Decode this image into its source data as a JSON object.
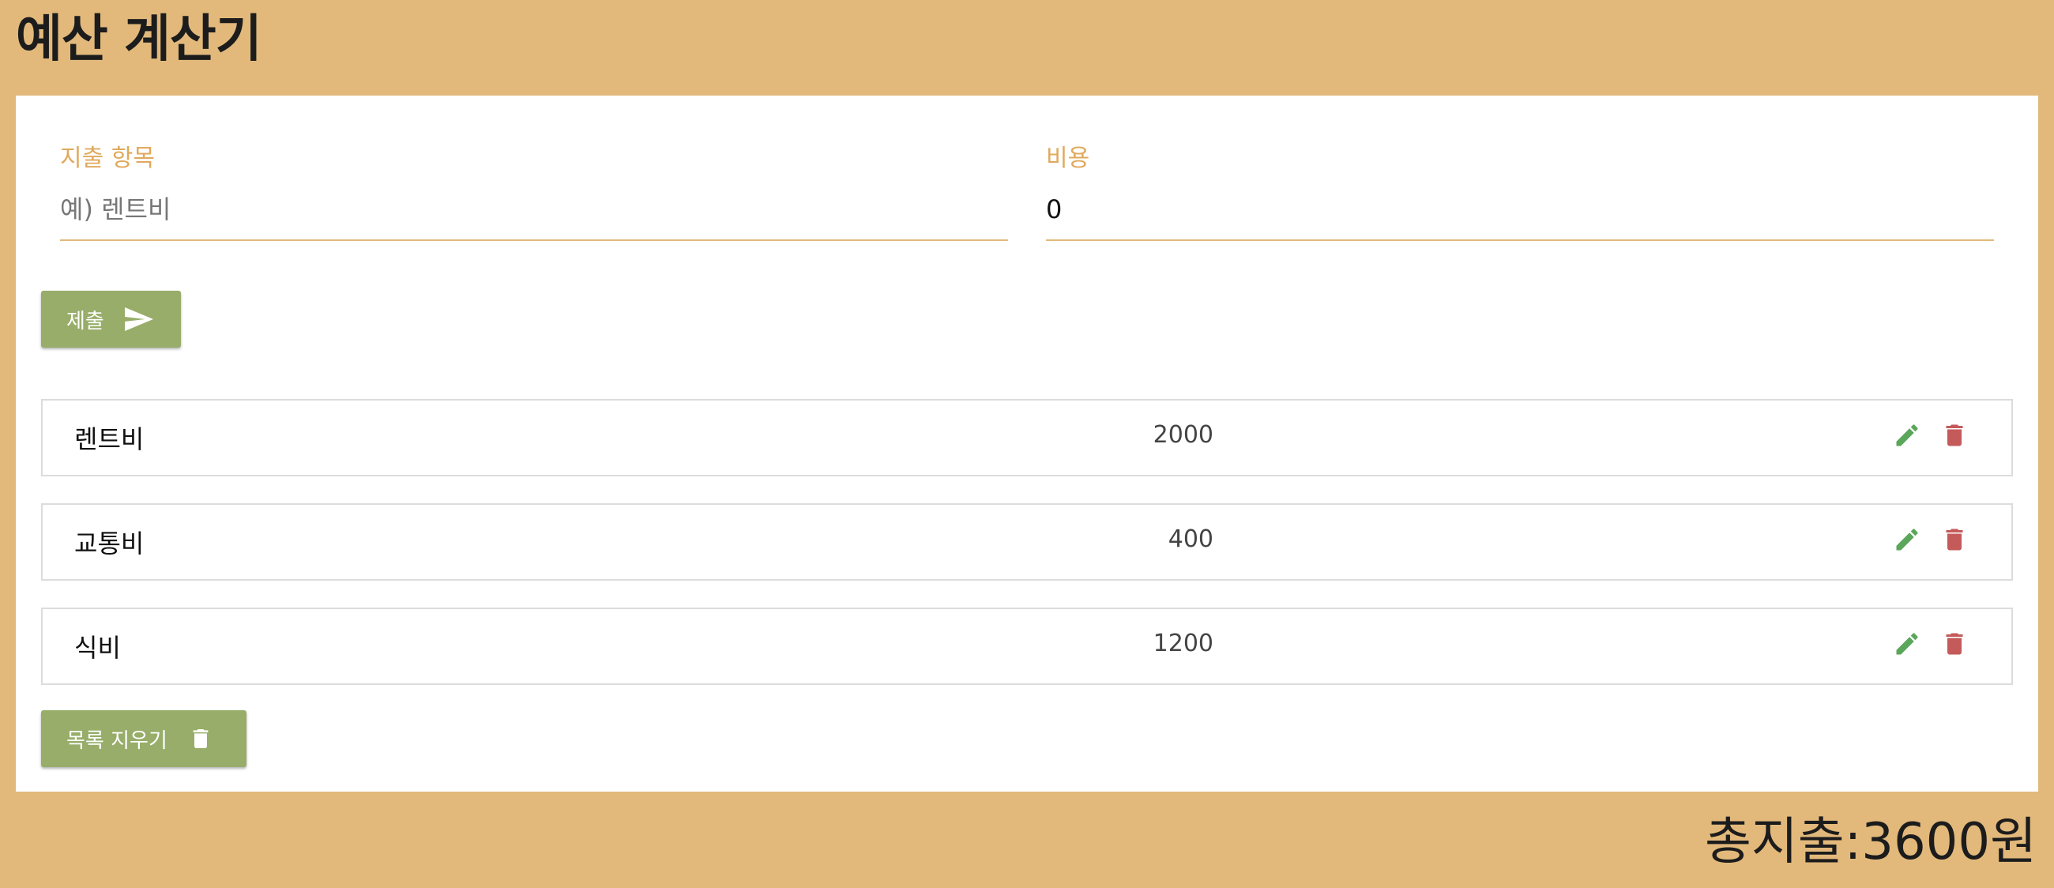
{
  "app": {
    "title": "예산 계산기"
  },
  "form": {
    "name_label": "지출 항목",
    "name_placeholder": "예) 렌트비",
    "name_value": "",
    "cost_label": "비용",
    "cost_value": "0",
    "submit_label": "제출"
  },
  "expenses": [
    {
      "name": "렌트비",
      "amount": "2000"
    },
    {
      "name": "교통비",
      "amount": "400"
    },
    {
      "name": "식비",
      "amount": "1200"
    }
  ],
  "clear_label": "목록 지우기",
  "total_text": "총지출:3600원",
  "colors": {
    "background": "#e2b97b",
    "label": "#e0a95d",
    "button": "#97ad69",
    "edit_icon": "#5aa65a",
    "delete_icon": "#c45a5a"
  },
  "icons": {
    "submit": "send-icon",
    "edit": "pencil-icon",
    "delete": "trash-icon",
    "clear": "trash-icon"
  }
}
